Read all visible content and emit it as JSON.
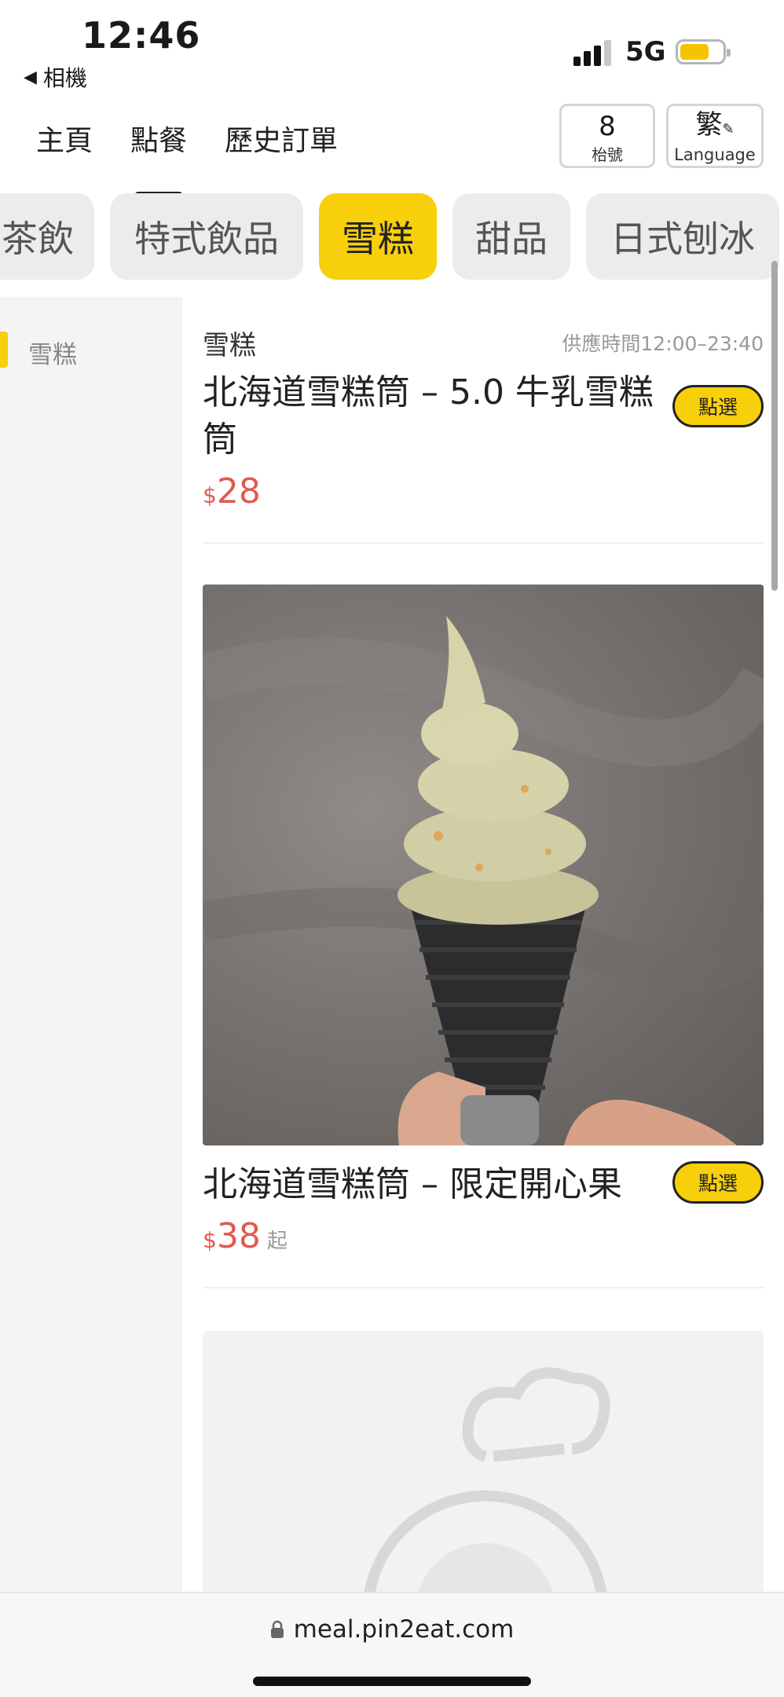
{
  "status": {
    "time": "12:46",
    "back_label": "相機",
    "network": "5G"
  },
  "nav": {
    "tabs": [
      {
        "label": "主頁"
      },
      {
        "label": "點餐"
      },
      {
        "label": "歷史訂單"
      }
    ],
    "table_number": "8",
    "table_label": "枱號",
    "lang_char": "繁",
    "lang_label": "Language"
  },
  "categories": [
    "茶飲",
    "特式飲品",
    "雪糕",
    "甜品",
    "日式刨冰"
  ],
  "active_category": "雪糕",
  "sidebar": {
    "items": [
      {
        "label": "雪糕"
      }
    ]
  },
  "section": {
    "title": "雪糕",
    "serve_time": "供應時間12:00–23:40"
  },
  "items": [
    {
      "name": "北海道雪糕筒 – 5.0 牛乳雪糕筒",
      "currency": "$",
      "price": "28",
      "suffix": "",
      "button": "點選"
    },
    {
      "name": "北海道雪糕筒 – 限定開心果",
      "currency": "$",
      "price": "38",
      "suffix": "起",
      "button": "點選"
    }
  ],
  "browser": {
    "url": "meal.pin2eat.com"
  }
}
